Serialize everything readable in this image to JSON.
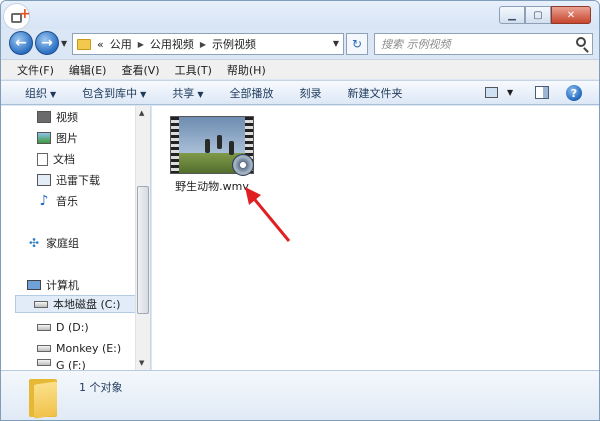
{
  "titlebar": {
    "min_icon": "minimize-icon",
    "max_icon": "maximize-icon",
    "close_icon": "close-icon"
  },
  "address": {
    "prefix": "«",
    "crumbs": [
      "公用",
      "公用视频",
      "示例视频"
    ]
  },
  "search": {
    "placeholder": "搜索 示例视频"
  },
  "menu": [
    "文件(F)",
    "编辑(E)",
    "查看(V)",
    "工具(T)",
    "帮助(H)"
  ],
  "commands": {
    "organize": "组织",
    "include_library": "包含到库中",
    "share": "共享",
    "play_all": "全部播放",
    "burn": "刻录",
    "new_folder": "新建文件夹"
  },
  "nav": {
    "libraries": [
      "视频",
      "图片",
      "文档",
      "迅雷下载",
      "音乐"
    ],
    "homegroup": "家庭组",
    "computer": "计算机",
    "drives": [
      "本地磁盘 (C:)",
      "D (D:)",
      "Monkey (E:)",
      "G (F:)"
    ]
  },
  "files": [
    {
      "name": "野生动物.wmv"
    }
  ],
  "status": {
    "count": "1 个对象"
  },
  "colors": {
    "accent": "#2b6fc2",
    "arrow": "#e02020",
    "selection": "#e1ecf8"
  }
}
